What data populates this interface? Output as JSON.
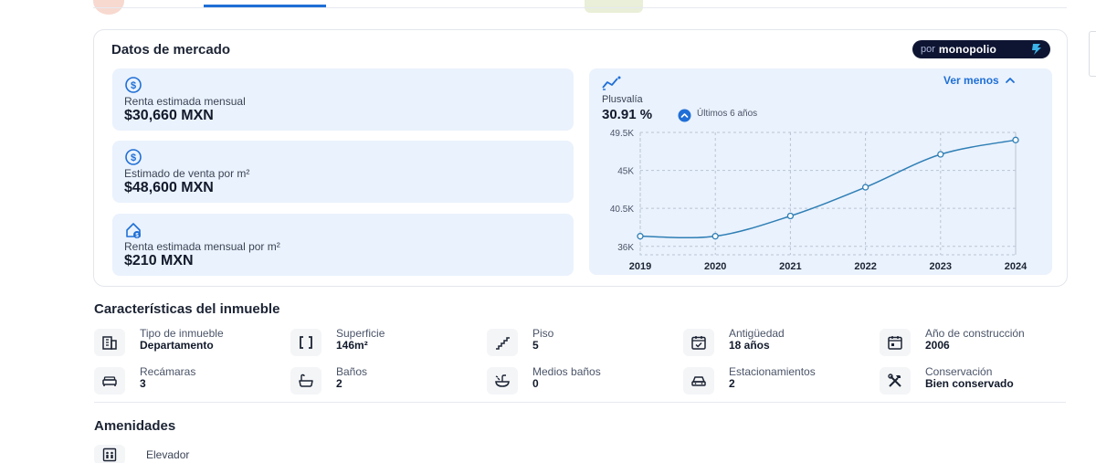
{
  "market": {
    "title": "Datos de mercado",
    "brand": {
      "prefix": "por",
      "name": "monopolio"
    },
    "stats": [
      {
        "icon": "dollar-circle-icon",
        "label": "Renta estimada mensual",
        "value": "$30,660 MXN"
      },
      {
        "icon": "dollar-circle-icon",
        "label": "Estimado de venta por m²",
        "value": "$48,600 MXN"
      },
      {
        "icon": "house-dollar-icon",
        "label": "Renta estimada mensual por m²",
        "value": "$210 MXN"
      }
    ],
    "plusvalia": {
      "label": "Plusvalía",
      "value": "30.91 %",
      "period": "Últimos 6 años",
      "toggle_label": "Ver menos"
    }
  },
  "chart_data": {
    "type": "line",
    "x": [
      "2019",
      "2020",
      "2021",
      "2022",
      "2023",
      "2024"
    ],
    "series": [
      {
        "values": [
          37200,
          37200,
          39600,
          43000,
          46900,
          48600
        ]
      }
    ],
    "yticks": [
      "36K",
      "40.5K",
      "45K",
      "49.5K"
    ],
    "ytick_values": [
      36000,
      40500,
      45000,
      49500
    ],
    "ylim": [
      35000,
      49500
    ],
    "grid": true,
    "title": "",
    "xlabel": "",
    "ylabel": ""
  },
  "characteristics": {
    "title": "Características del inmueble",
    "items": [
      {
        "icon": "building-icon",
        "label": "Tipo de inmueble",
        "value": "Departamento"
      },
      {
        "icon": "area-brackets-icon",
        "label": "Superficie",
        "value": "146m²"
      },
      {
        "icon": "stairs-icon",
        "label": "Piso",
        "value": "5"
      },
      {
        "icon": "calendar-check-icon",
        "label": "Antigüedad",
        "value": "18 años"
      },
      {
        "icon": "calendar-icon",
        "label": "Año de construcción",
        "value": "2006"
      },
      {
        "icon": "bed-icon",
        "label": "Recámaras",
        "value": "3"
      },
      {
        "icon": "bathtub-icon",
        "label": "Baños",
        "value": "2"
      },
      {
        "icon": "sink-icon",
        "label": "Medios baños",
        "value": "0"
      },
      {
        "icon": "car-icon",
        "label": "Estacionamientos",
        "value": "2"
      },
      {
        "icon": "tools-icon",
        "label": "Conservación",
        "value": "Bien conservado"
      }
    ]
  },
  "amenities": {
    "title": "Amenidades",
    "items": [
      {
        "icon": "elevator-icon",
        "label": "Elevador"
      }
    ]
  },
  "colors": {
    "accent": "#1f6fd6",
    "card_bg": "#eaf2fd",
    "line": "#2f7fb5",
    "brand_bg": "#0e1532"
  }
}
